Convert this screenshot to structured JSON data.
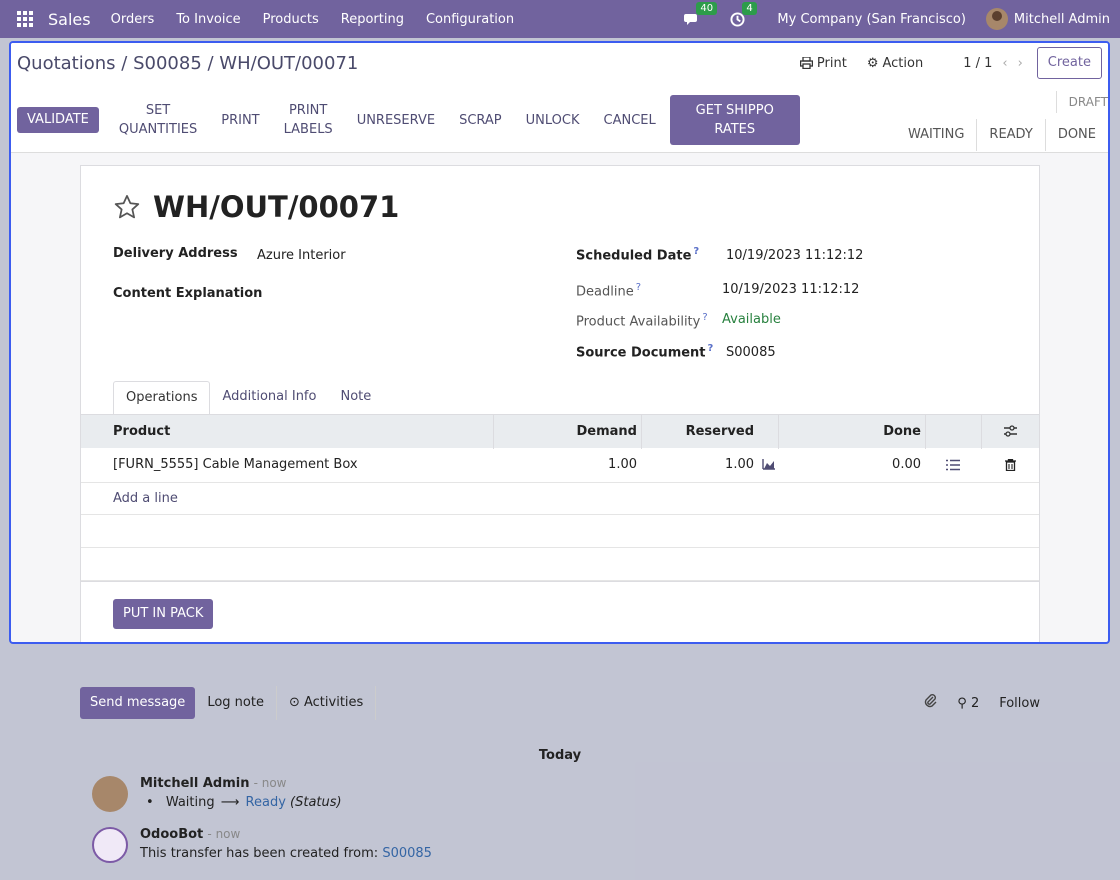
{
  "navbar": {
    "brand": "Sales",
    "menu": [
      "Orders",
      "To Invoice",
      "Products",
      "Reporting",
      "Configuration"
    ],
    "messages_count": "40",
    "activities_count": "4",
    "company": "My Company (San Francisco)",
    "user": "Mitchell Admin"
  },
  "breadcrumb": {
    "items": [
      "Quotations",
      "S00085",
      "WH/OUT/00071"
    ]
  },
  "control": {
    "print_label": "Print",
    "action_label": "Action",
    "pager": "1 / 1",
    "create_label": "Create"
  },
  "actions": {
    "validate": "Validate",
    "set_quantities_1": "Set",
    "set_quantities_2": "Quantities",
    "print": "Print",
    "print_labels_1": "Print",
    "print_labels_2": "Labels",
    "unreserve": "Unreserve",
    "scrap": "Scrap",
    "unlock": "Unlock",
    "cancel": "Cancel",
    "shippo_1": "Get Shippo",
    "shippo_2": "Rates"
  },
  "status": {
    "draft": "DRAFT",
    "waiting": "Waiting",
    "ready": "Ready",
    "done": "Done"
  },
  "record": {
    "name": "WH/OUT/00071",
    "delivery_address_label": "Delivery Address",
    "delivery_address": "Azure Interior",
    "content_explanation_label": "Content Explanation",
    "scheduled_date_label": "Scheduled Date",
    "scheduled_date": "10/19/2023 11:12:12",
    "deadline_label": "Deadline",
    "deadline": "10/19/2023 11:12:12",
    "availability_label": "Product Availability",
    "availability": "Available",
    "source_document_label": "Source Document",
    "source_document": "S00085",
    "help_mark": "?"
  },
  "tabs": [
    "Operations",
    "Additional Info",
    "Note"
  ],
  "operations": {
    "headers": {
      "product": "Product",
      "demand": "Demand",
      "reserved": "Reserved",
      "done": "Done"
    },
    "rows": [
      {
        "product": "[FURN_5555] Cable Management Box",
        "demand": "1.00",
        "reserved": "1.00",
        "done": "0.00"
      }
    ],
    "add_line": "Add a line"
  },
  "put_in_pack": "Put in Pack",
  "chatter": {
    "send_message": "Send message",
    "log_note": "Log note",
    "activities": "Activities",
    "followers_count": "2",
    "follow": "Follow",
    "today": "Today",
    "messages": [
      {
        "author": "Mitchell Admin",
        "time": "- now",
        "from": "Waiting",
        "to": "Ready",
        "field": "(Status)"
      },
      {
        "author": "OdooBot",
        "time": "- now",
        "text": "This transfer has been created from:",
        "link": "S00085"
      }
    ]
  },
  "colors": {
    "brand": "#71639e",
    "modal_border": "#3c5cf0",
    "success": "#28813f",
    "badge": "#2d9c4a"
  }
}
